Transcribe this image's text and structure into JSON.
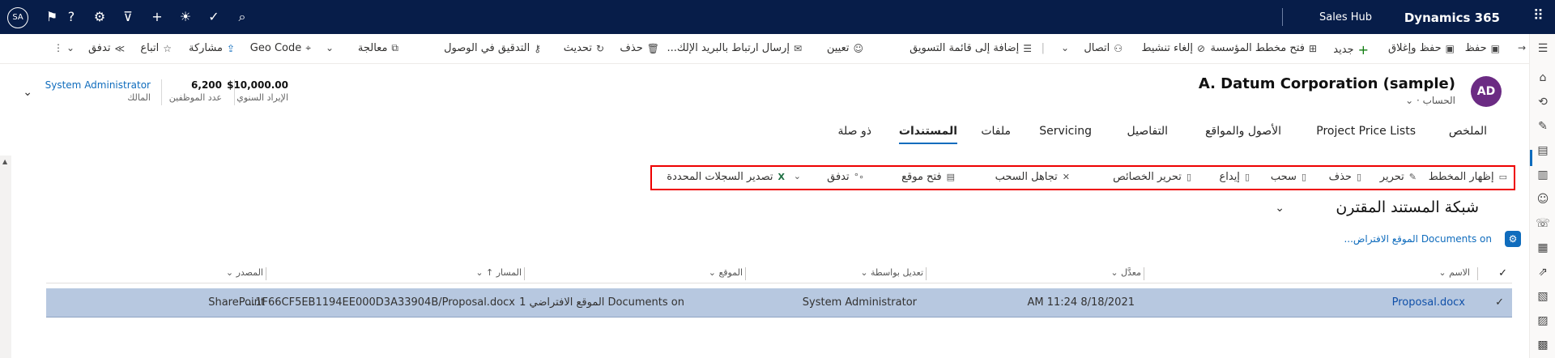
{
  "topbar": {
    "user_initials": "SA",
    "app_name": "Sales Hub",
    "product": "Dynamics 365",
    "icons": [
      "search-icon",
      "check-circle-icon",
      "lightbulb-icon",
      "plus-icon",
      "filter-icon",
      "gear-icon",
      "help-icon",
      "assistant-icon",
      "waffle-icon"
    ]
  },
  "commands": {
    "save": "حفظ",
    "save_close": "حفظ وإغلاق",
    "new": "جديد",
    "open_org_chart": "فتح مخطط المؤسسة",
    "deactivate": "إلغاء تنشيط",
    "connect": "اتصال",
    "add_marketing_list": "إضافة إلى قائمة التسويق",
    "assign": "تعيين",
    "email_link": "إرسال ارتباط بالبريد الإلك...",
    "delete": "حذف",
    "refresh": "تحديث",
    "check_access": "التدقيق في الوصول",
    "process": "معالجة",
    "geo_code": "Geo Code",
    "share": "مشاركة",
    "follow": "اتباع",
    "flow": "تدفق"
  },
  "header": {
    "avatar_initials": "AD",
    "title": "A. Datum Corporation (sample)",
    "subtitle": "الحساب ·",
    "annual_revenue_value": "$10,000.00",
    "annual_revenue_label": "الإيراد السنوي",
    "employees_value": "6,200",
    "employees_label": "عدد الموظفين",
    "owner_value": "System Administrator",
    "owner_label": "المالك"
  },
  "tabs": [
    "الملخص",
    "Project Price Lists",
    "الأصول والمواقع",
    "التفاصيل",
    "Servicing",
    "ملفات",
    "المستندات",
    "ذو صلة"
  ],
  "doc_toolbar": {
    "show_layout": "إظهار المخطط",
    "edit": "تحرير",
    "delete": "حذف",
    "checkout": "سحب",
    "checkin": "إيداع",
    "edit_properties": "تحرير الخصائص",
    "discard_checkout": "تجاهل السحب",
    "open_location": "فتح موقع",
    "flow": "تدفق",
    "export_selected": "تصدير السجلات المحددة"
  },
  "grid": {
    "title": "شبكة المستند المقترن",
    "location_link": "Documents on الموقع الافتراض...",
    "columns": {
      "name": "الاسم",
      "modified": "معدَّل",
      "modified_by": "تعديل بواسطة",
      "location": "الموقع",
      "path": "المسار",
      "source": "المصدر"
    },
    "rows": [
      {
        "name": "Proposal.docx",
        "modified": "AM 11:24 8/18/2021",
        "modified_by": "System Administrator",
        "location": "Documents on الموقع الافتراضي 1",
        "path": "...1F66CF5EB1194EE000D3A33904B/Proposal.docx",
        "source": "SharePoint"
      }
    ]
  }
}
